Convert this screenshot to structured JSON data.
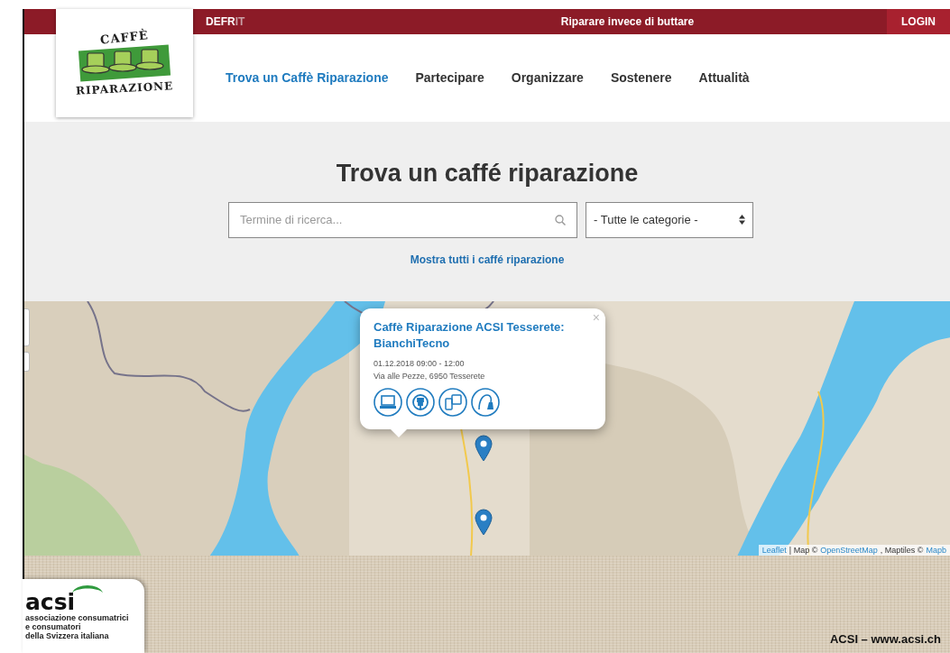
{
  "topbar": {
    "languages": [
      {
        "label": "DE",
        "selected": false
      },
      {
        "label": "FR",
        "selected": false
      },
      {
        "label": "IT",
        "selected": true
      }
    ],
    "tagline": "Riparare invece di buttare",
    "login": "LOGIN"
  },
  "logo": {
    "line_1": "CAFFÈ",
    "line_2": "RIPARAZIONE"
  },
  "nav": [
    {
      "label": "Trova un Caffè Riparazione",
      "selected": true
    },
    {
      "label": "Partecipare",
      "selected": false
    },
    {
      "label": "Organizzare",
      "selected": false
    },
    {
      "label": "Sostenere",
      "selected": false
    },
    {
      "label": "Attualità",
      "selected": false
    }
  ],
  "search": {
    "title": "Trova un caffé riparazione",
    "placeholder": "Termine di ricerca...",
    "category": "- Tutte le categorie -",
    "show_all": "Mostra tutti i caffé riparazione"
  },
  "map": {
    "popup": {
      "title": "Caffè Riparazione ACSI Tesserete: BianchiTecno",
      "date": "01.12.2018 09:00 - 12:00",
      "address": "Via alle Pezze, 6950 Tesserete",
      "close": "×"
    },
    "attribution": [
      {
        "kind": "link",
        "text": "Leaflet"
      },
      {
        "kind": "text",
        "text": "| Map ©"
      },
      {
        "kind": "link",
        "text": "OpenStreetMap"
      },
      {
        "kind": "text",
        "text": ", Maptiles ©"
      },
      {
        "kind": "link",
        "text": "Mapb"
      }
    ]
  },
  "footer": {
    "logo": {
      "name": "acsi",
      "lines": [
        "associazione consumatrici",
        "e consumatori",
        "della Svizzera italiana"
      ]
    },
    "caption": "ACSI – www.acsi.ch"
  }
}
